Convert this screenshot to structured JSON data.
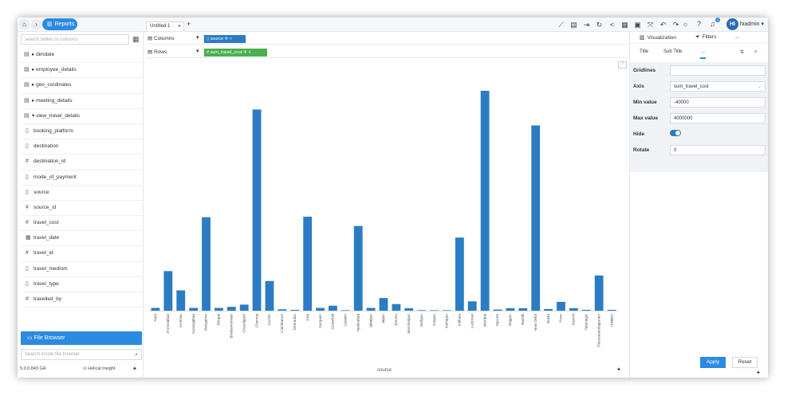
{
  "topbar": {
    "reports_label": "Reports",
    "tab_label": "Untitled 1",
    "tab_close": "×",
    "tab_add": "+",
    "username": "hiadmin",
    "avatar_initials": "HI",
    "notification_count": "2"
  },
  "sidebar": {
    "search_placeholder": "search tables or columns",
    "items": [
      {
        "label": "dimdate",
        "icon": "table-icon"
      },
      {
        "label": "employee_details",
        "icon": "table-icon"
      },
      {
        "label": "geo_cordinates",
        "icon": "table-icon"
      },
      {
        "label": "meeting_details",
        "icon": "table-icon"
      },
      {
        "label": "view_travel_details",
        "icon": "table-icon"
      },
      {
        "label": "booking_platform",
        "icon": "text-field-icon"
      },
      {
        "label": "destination",
        "icon": "text-field-icon"
      },
      {
        "label": "destination_id",
        "icon": "number-field-icon"
      },
      {
        "label": "mode_of_payment",
        "icon": "text-field-icon"
      },
      {
        "label": "source",
        "icon": "text-field-icon"
      },
      {
        "label": "source_id",
        "icon": "number-field-icon"
      },
      {
        "label": "travel_cost",
        "icon": "number-field-icon"
      },
      {
        "label": "travel_date",
        "icon": "calendar-icon"
      },
      {
        "label": "travel_id",
        "icon": "number-field-icon"
      },
      {
        "label": "travel_medium",
        "icon": "text-field-icon"
      },
      {
        "label": "travel_type",
        "icon": "text-field-icon"
      },
      {
        "label": "travelled_by",
        "icon": "number-field-icon"
      }
    ],
    "file_browser_label": "File Browser",
    "file_search_placeholder": "Search inside file browser",
    "version": "5.0.0.843 GA",
    "helical_label": "Helical Insight"
  },
  "shelves": {
    "columns_label": "Columns",
    "rows_label": "Rows",
    "column_pill": "source",
    "row_pill": "sum_travel_cost"
  },
  "right_panel": {
    "tab_visualization": "Visualization",
    "tab_filters": "Filters",
    "tab_more": "...",
    "sub_title": "Title",
    "sub_subtitle": "Sub Title",
    "sub_more": "...",
    "gridlines_label": "Gridlines",
    "gridlines_value": "",
    "axis_label": "Axis",
    "axis_value": "sum_travel_cost",
    "min_label": "Min value",
    "min_value": "-40000",
    "max_label": "Max value",
    "max_value": "4000000",
    "hide_label": "Hide",
    "hide_on": true,
    "rotate_label": "Rotate",
    "rotate_value": "0",
    "apply_label": "Apply",
    "reset_label": "Reset"
  },
  "chart_data": {
    "type": "bar",
    "xlabel": "source",
    "ylabel": "",
    "ylim": [
      -40000,
      4000000
    ],
    "color": "#2b7cc4",
    "categories": [
      "Agra",
      "Ahmedabad",
      "Amritsar",
      "Aurangabad",
      "Bangalore",
      "Bhopal",
      "Bhubaneshwar",
      "Chandigarh",
      "Chennai",
      "Cochin",
      "Coimbatore",
      "Dehradun",
      "Goa",
      "Gurgaon",
      "Guwahati",
      "Gwalior",
      "Hyderabad",
      "Jabalpur",
      "Jaipur",
      "Jammu",
      "Jamshedpur",
      "Jodhpur",
      "Kanpur",
      "Kolhapur",
      "Kolkata",
      "Lucknow",
      "Mumbai",
      "Mysore",
      "Nagpur",
      "Nashik",
      "New Delhi",
      "Noida",
      "Pune",
      "Ranchi",
      "Tatanagar",
      "Thiruvananthapuram",
      "Udaipur"
    ],
    "values": [
      50000,
      720000,
      370000,
      50000,
      1700000,
      50000,
      70000,
      110000,
      3660000,
      540000,
      25000,
      15000,
      1710000,
      50000,
      90000,
      5000,
      1540000,
      50000,
      230000,
      120000,
      45000,
      10000,
      5000,
      5000,
      1330000,
      170000,
      4000000,
      20000,
      45000,
      45000,
      3370000,
      30000,
      160000,
      45000,
      15000,
      640000,
      15000
    ]
  }
}
